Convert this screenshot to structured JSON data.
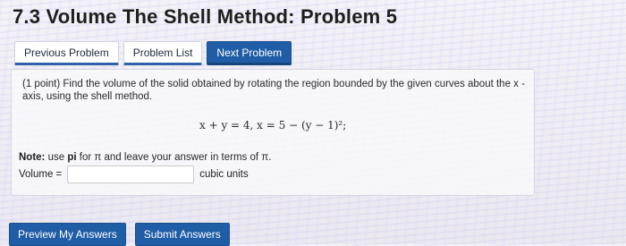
{
  "page": {
    "title": "7.3 Volume The Shell Method: Problem 5"
  },
  "nav": {
    "previous_label": "Previous Problem",
    "list_label": "Problem List",
    "next_label": "Next Problem"
  },
  "problem": {
    "points": "(1 point)",
    "text": "Find the volume of the solid obtained by rotating the region bounded by the given curves about the x - axis, using the shell method.",
    "equation": "x + y = 4,    x = 5 − (y − 1)²;",
    "note_bold": "Note:",
    "note_text": " use ",
    "note_pi": "pi",
    "note_rest": " for π and leave your answer in terms of π."
  },
  "answer": {
    "label": "Volume =",
    "value": "",
    "placeholder": "",
    "units": "cubic units"
  },
  "actions": {
    "preview_label": "Preview My Answers",
    "submit_label": "Submit Answers"
  },
  "colors": {
    "primary": "#1f5da6",
    "accent_border": "#2f62a8"
  }
}
